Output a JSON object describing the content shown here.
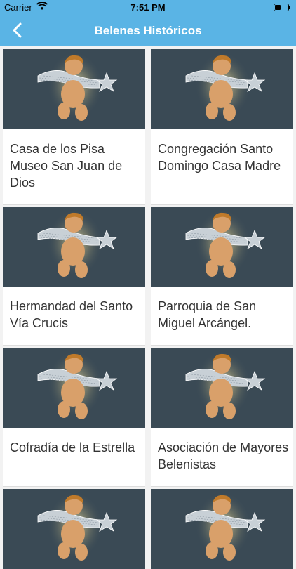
{
  "status_bar": {
    "carrier": "Carrier",
    "time": "7:51 PM"
  },
  "nav": {
    "title": "Belenes Históricos"
  },
  "colors": {
    "accent": "#5ab4e5",
    "image_bg": "#3a4a55"
  },
  "icons": {
    "back": "chevron-left-icon",
    "wifi": "wifi-icon",
    "battery": "battery-icon",
    "thumbnail": "angel-with-star-image"
  },
  "items": [
    {
      "title": "Casa de los Pisa Museo San Juan de Dios"
    },
    {
      "title": "Congregación Santo Domingo Casa Madre"
    },
    {
      "title": "Hermandad del Santo Vía Crucis"
    },
    {
      "title": "Parroquia de San Miguel Arcángel."
    },
    {
      "title": "Cofradía de la Estrella"
    },
    {
      "title": "Asociación de Mayores Belenistas"
    },
    {
      "title": ""
    },
    {
      "title": ""
    }
  ]
}
